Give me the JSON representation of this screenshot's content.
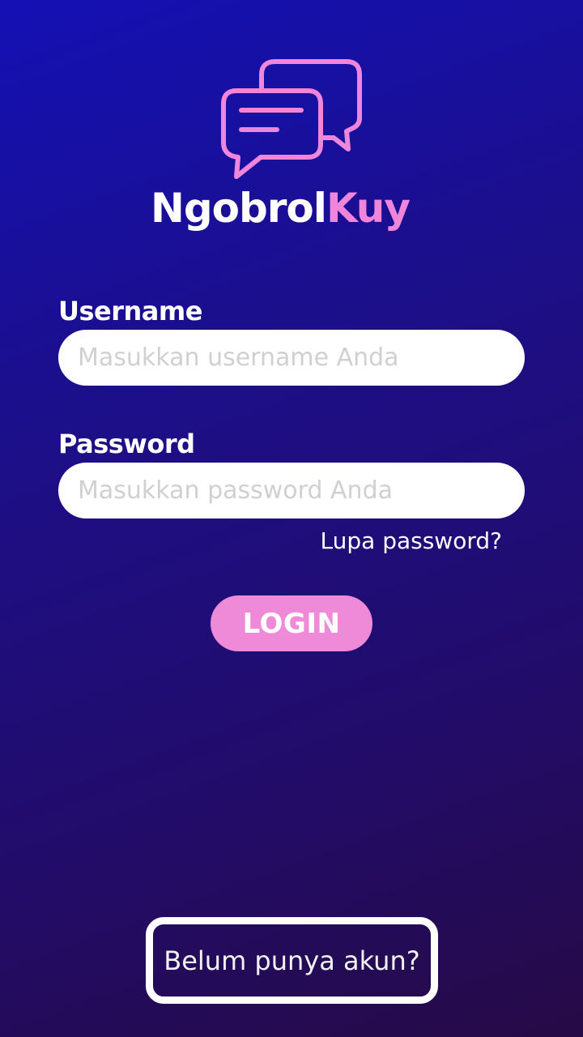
{
  "brand": {
    "name_part1": "Ngobrol",
    "name_part2": "Kuy"
  },
  "colors": {
    "accent_pink": "#ef86dc",
    "background_top": "#1410b4",
    "background_bottom": "#260a46",
    "input_background": "#ffffff"
  },
  "icons": {
    "logo": "chat-bubbles-icon"
  },
  "form": {
    "username_label": "Username",
    "username_value": "",
    "username_placeholder": "Masukkan username Anda",
    "password_label": "Password",
    "password_value": "",
    "password_placeholder": "Masukkan password Anda",
    "forgot_password": "Lupa password?",
    "login_button": "LOGIN"
  },
  "footer": {
    "register_button": "Belum punya akun?"
  }
}
